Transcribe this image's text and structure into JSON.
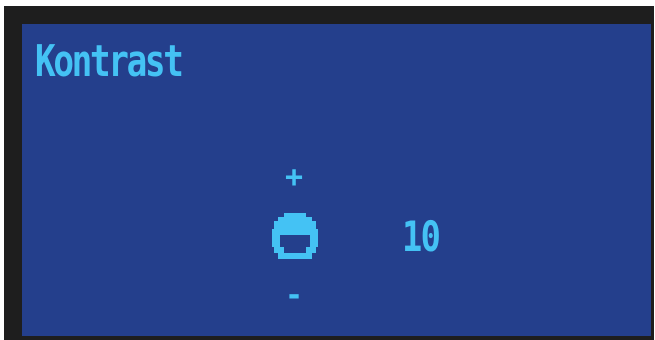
{
  "screen": {
    "title": "Kontrast",
    "increase_label": "+",
    "decrease_label": "-",
    "value": "10",
    "knob_icon": "contrast-knob-icon"
  },
  "colors": {
    "frame": "#1e1e1e",
    "background": "#243f8c",
    "accent": "#44c2f4"
  }
}
